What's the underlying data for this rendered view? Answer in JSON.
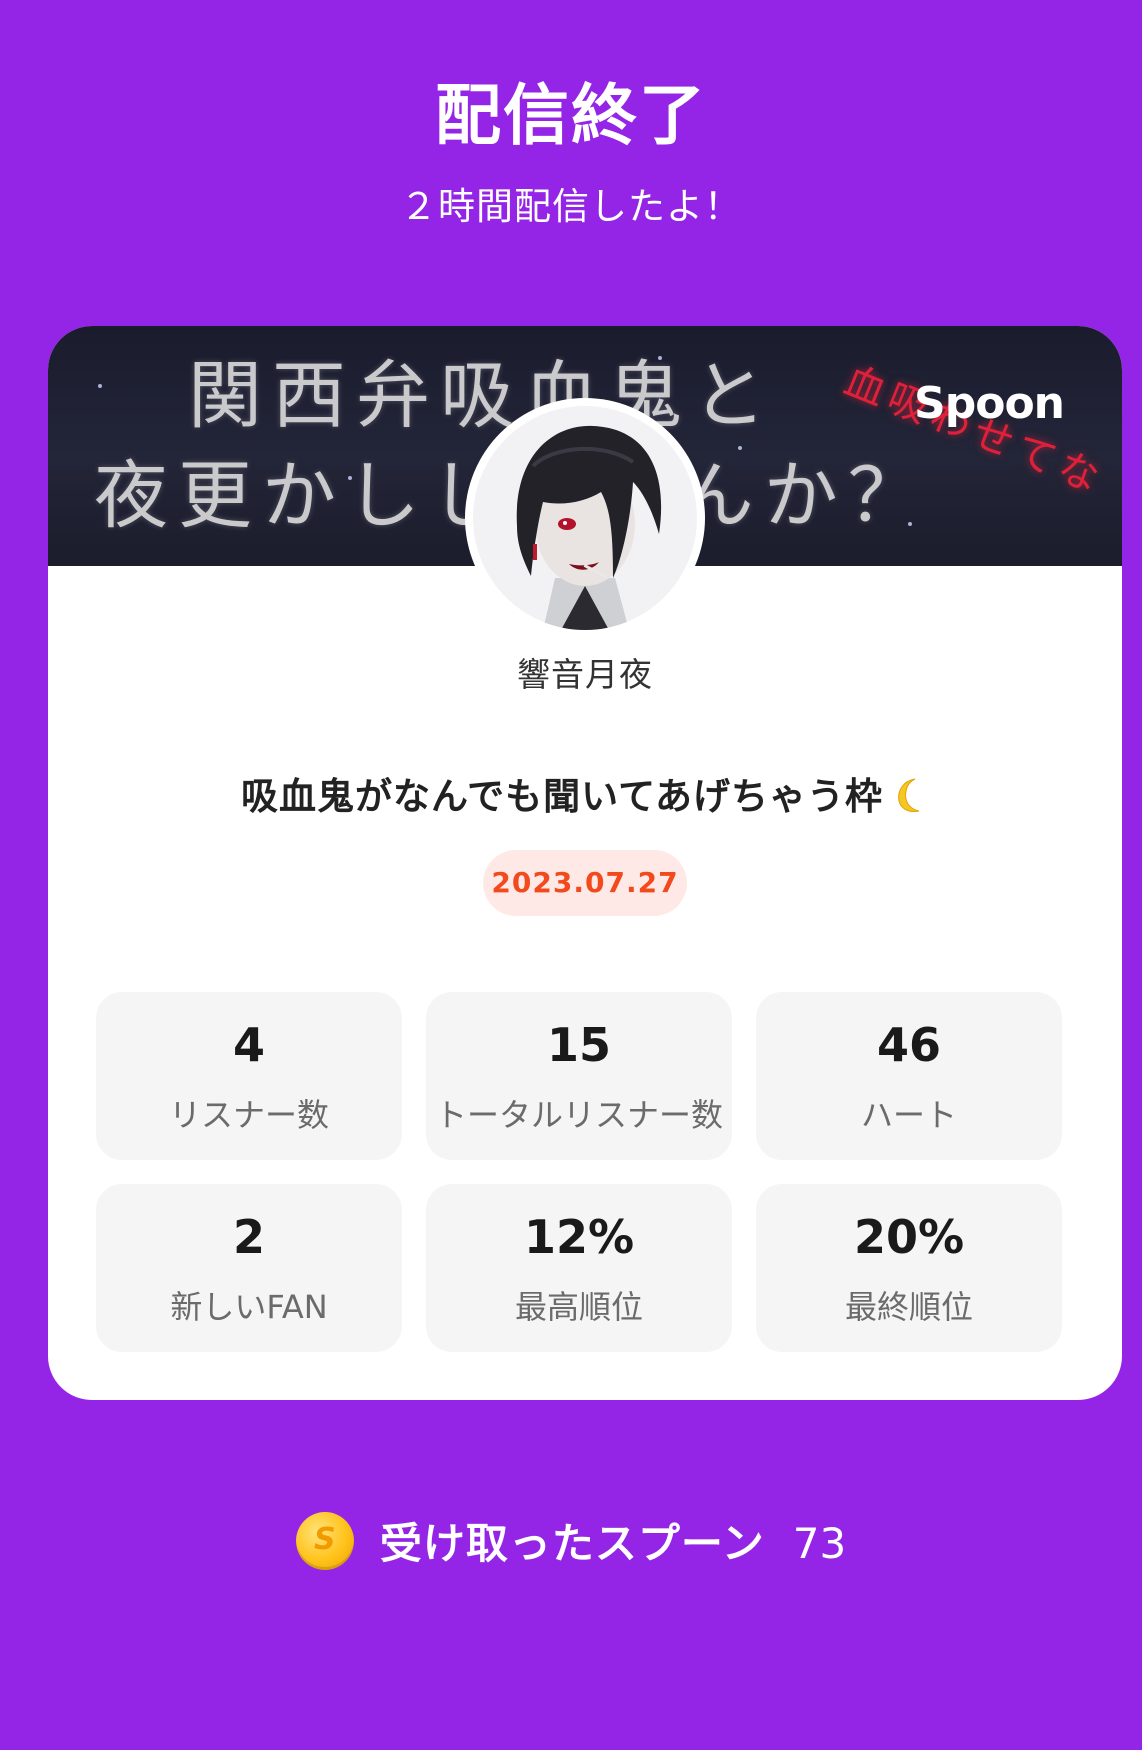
{
  "header": {
    "title": "配信終了",
    "subtitle": "２時間配信したよ！"
  },
  "card": {
    "banner": {
      "line1": "関西弁吸血鬼と",
      "line2": "夜更かししませんか？",
      "side_text": "血吸わせてな",
      "brand": "Spoon"
    },
    "username": "響音月夜",
    "stream_title": "吸血鬼がなんでも聞いてあげちゃう枠",
    "title_emoji": "crescent-moon-icon",
    "date": "2023.07.27",
    "stats": [
      {
        "value": "4",
        "label": "リスナー数"
      },
      {
        "value": "15",
        "label": "トータルリスナー数"
      },
      {
        "value": "46",
        "label": "ハート"
      },
      {
        "value": "2",
        "label": "新しいFAN"
      },
      {
        "value": "12%",
        "label": "最高順位"
      },
      {
        "value": "20%",
        "label": "最終順位"
      }
    ]
  },
  "footer": {
    "coin_icon": "spoon-coin-icon",
    "coin_letter": "S",
    "received_label": "受け取ったスプーン",
    "received_count": "73"
  },
  "colors": {
    "background": "#9525E6",
    "date_text": "#F24A1D",
    "date_bg": "#FFE9E6",
    "stat_bg": "#F5F5F5"
  }
}
